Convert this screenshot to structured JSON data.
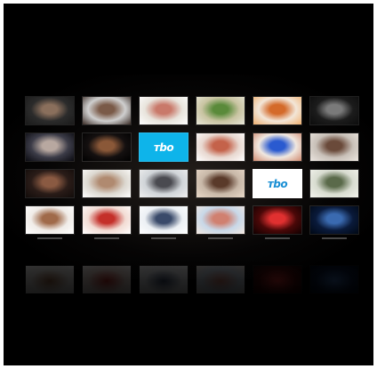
{
  "screen": {
    "background": "#000000"
  },
  "logo": {
    "text": "TBO",
    "blue_bg": "#0eb4ea",
    "white_bg": "#ffffff",
    "blue_text": "#1a8fd4"
  },
  "tiles": [
    {
      "kind": "thumb",
      "icon": "portrait-thumbnail",
      "colors": [
        "#2b2b2b",
        "#8a6f5c",
        "#1a1a1a"
      ]
    },
    {
      "kind": "thumb",
      "icon": "couple-thumbnail",
      "colors": [
        "#cfcfcf",
        "#7a5a48",
        "#3a2c26"
      ]
    },
    {
      "kind": "thumb",
      "icon": "face-thumbnail",
      "colors": [
        "#e8e4dc",
        "#c9796a",
        "#ffffff"
      ]
    },
    {
      "kind": "thumb",
      "icon": "field-thumbnail",
      "colors": [
        "#c9c4a2",
        "#5a8a3a",
        "#e8e6d8"
      ]
    },
    {
      "kind": "thumb",
      "icon": "fruit-thumbnail",
      "colors": [
        "#f2e6d8",
        "#d46a2a",
        "#f0b070"
      ]
    },
    {
      "kind": "thumb",
      "icon": "dark-portrait-thumbnail",
      "colors": [
        "#1c1c1c",
        "#7a7a7a",
        "#0c0c0c"
      ]
    },
    {
      "kind": "thumb",
      "icon": "hair-thumbnail",
      "colors": [
        "#3c3c48",
        "#b8a8a0",
        "#0a0a10"
      ]
    },
    {
      "kind": "thumb",
      "icon": "silhouette-thumbnail",
      "colors": [
        "#141010",
        "#8a5838",
        "#000000"
      ]
    },
    {
      "kind": "logo-blue",
      "icon": "tbo-logo-icon"
    },
    {
      "kind": "thumb",
      "icon": "kids-thumbnail",
      "colors": [
        "#e8d8d0",
        "#c4624a",
        "#ffffff"
      ]
    },
    {
      "kind": "thumb",
      "icon": "blue-hat-thumbnail",
      "colors": [
        "#f0e8e0",
        "#2a5ad0",
        "#d08a70"
      ]
    },
    {
      "kind": "thumb",
      "icon": "woman-thumbnail",
      "colors": [
        "#c8c0b8",
        "#6a4a3a",
        "#ece6e0"
      ]
    },
    {
      "kind": "thumb",
      "icon": "dark-figure-thumbnail",
      "colors": [
        "#2a1c18",
        "#8a5a42",
        "#120c0a"
      ]
    },
    {
      "kind": "thumb",
      "icon": "man-thumbnail",
      "colors": [
        "#dcd8d0",
        "#b08a70",
        "#ffffff"
      ]
    },
    {
      "kind": "thumb",
      "icon": "group-thumbnail",
      "colors": [
        "#d0d4d8",
        "#4a4a50",
        "#f0f0f0"
      ]
    },
    {
      "kind": "thumb",
      "icon": "crowd-thumbnail",
      "colors": [
        "#c8b8a8",
        "#5a3a2a",
        "#e8d8c8"
      ]
    },
    {
      "kind": "logo-white",
      "icon": "tbo-logo-icon"
    },
    {
      "kind": "thumb",
      "icon": "street-thumbnail",
      "colors": [
        "#d8dcd0",
        "#5a6a4a",
        "#f4f4ee"
      ]
    },
    {
      "kind": "thumb",
      "icon": "reclining-thumbnail",
      "colors": [
        "#f0ece8",
        "#a06a4a",
        "#ffffff"
      ]
    },
    {
      "kind": "thumb",
      "icon": "flowers-thumbnail",
      "colors": [
        "#f2dcd4",
        "#c4302a",
        "#ffffff"
      ]
    },
    {
      "kind": "thumb",
      "icon": "outfit-thumbnail",
      "colors": [
        "#ecf0f4",
        "#3a4a6a",
        "#ffffff"
      ]
    },
    {
      "kind": "thumb",
      "icon": "smile-thumbnail",
      "colors": [
        "#c8d8e8",
        "#d08070",
        "#f4e8e0"
      ]
    },
    {
      "kind": "thumb",
      "icon": "red-lights-thumbnail",
      "colors": [
        "#4a0808",
        "#e03030",
        "#100000"
      ]
    },
    {
      "kind": "thumb",
      "icon": "blue-pattern-thumbnail",
      "colors": [
        "#0a1a3a",
        "#3a6ab0",
        "#000814"
      ]
    }
  ]
}
